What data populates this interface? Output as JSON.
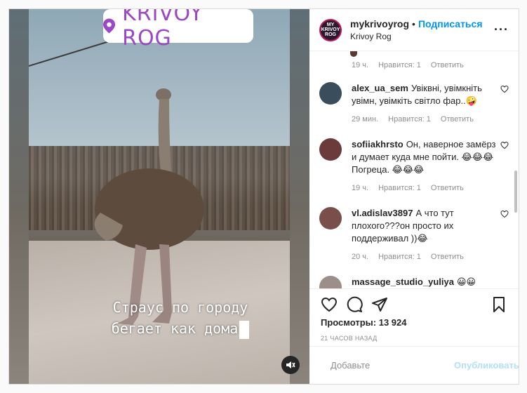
{
  "video": {
    "location_sticker": "KRIVOY ROG",
    "caption_line1": "Страус по городу",
    "caption_line2": "бегает как дома"
  },
  "header": {
    "username": "mykrivoyrog",
    "separator": "•",
    "follow_label": "Подписаться",
    "location": "Krivoy Rog",
    "avatar_text": "MY KRIVOY ROG"
  },
  "top_meta": {
    "time": "19 ч.",
    "likes": "Нравится: 1",
    "reply": "Ответить"
  },
  "comments": [
    {
      "user": "alex_ua_sem",
      "text": "Увiквні, увімкніть увімн, увімкіть світло фар..🤪",
      "time": "29 мин.",
      "likes": "Нравится: 1",
      "reply": "Ответить",
      "avatar_color": "#3a4d5c"
    },
    {
      "user": "sofiiakhrsto",
      "text": "Он, наверное замёрз и думает куда мне пойти. 😂😂😂 Погреца. 😂😂😂",
      "time": "19 ч.",
      "likes": "Нравится: 1",
      "reply": "Ответить",
      "avatar_color": "#6b3a3a"
    },
    {
      "user": "vl.adislav3897",
      "text": "А что тут плохого???он просто их поддерживал ))😂",
      "time": "20 ч.",
      "likes": "Нравится: 1",
      "reply": "Ответить",
      "avatar_color": "#7a4e4a"
    },
    {
      "user": "massage_studio_yuliya",
      "text": "😀😀",
      "time": "",
      "likes": "",
      "reply": "",
      "avatar_color": "#9c8e88"
    }
  ],
  "actions": {
    "views_label": "Просмотры:",
    "views_count": "13 924",
    "time_ago": "21 ЧАСОВ НАЗАД"
  },
  "composer": {
    "placeholder": "Добавьте",
    "publish_label": "Опубликовать"
  },
  "colors": {
    "accent": "#0095f6",
    "sticker_text": "#9b47c7"
  }
}
